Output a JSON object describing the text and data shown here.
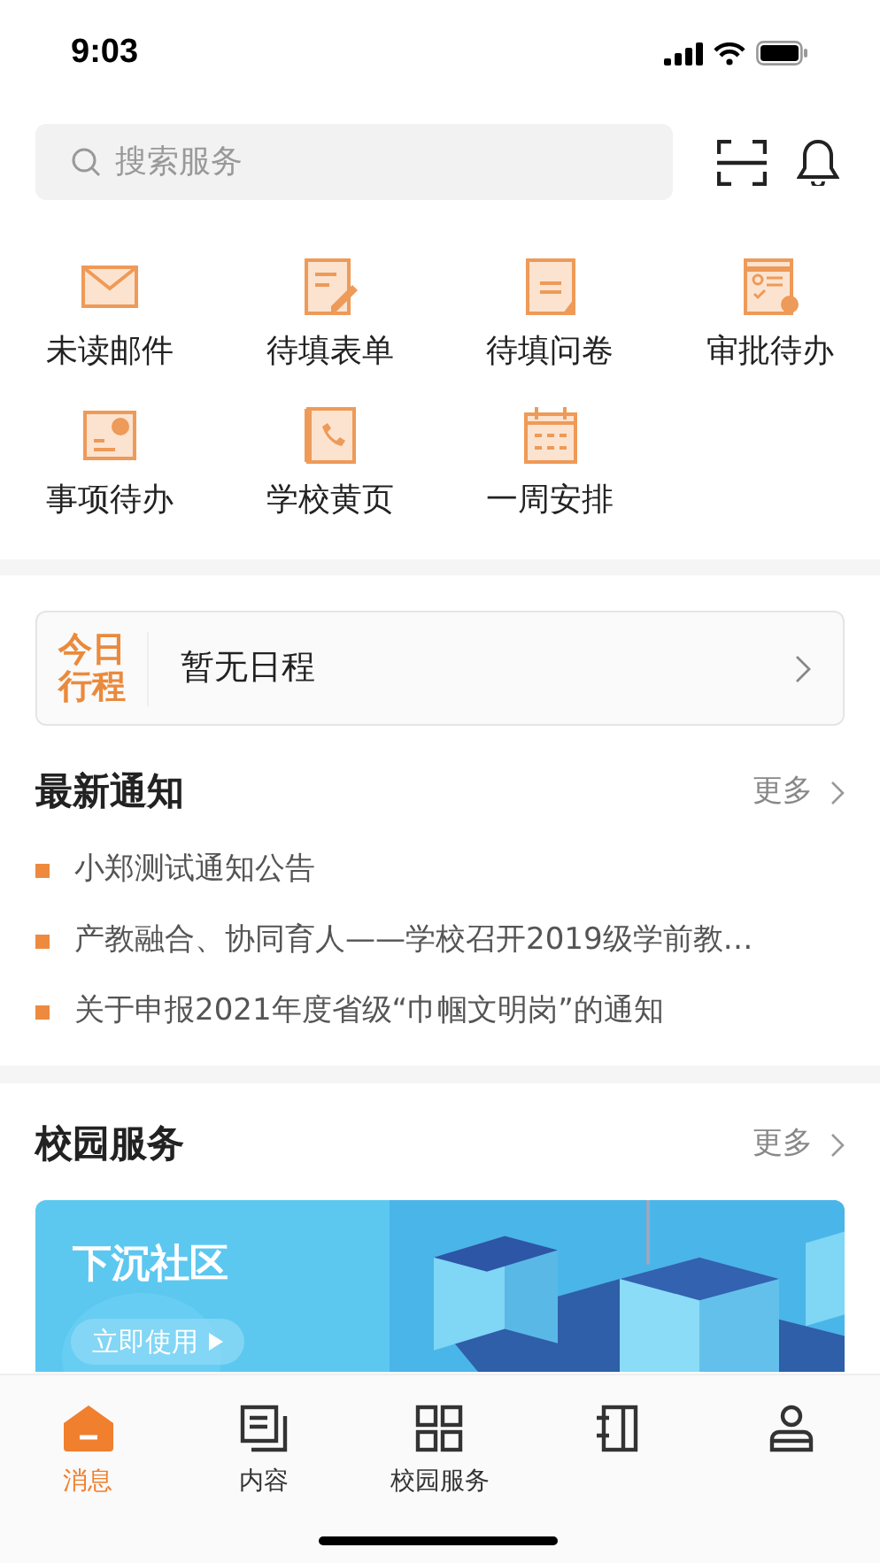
{
  "status_bar": {
    "time": "9:03"
  },
  "search": {
    "placeholder": "搜索服务"
  },
  "shortcuts": [
    {
      "label": "未读邮件",
      "kind": "mail"
    },
    {
      "label": "待填表单",
      "kind": "form"
    },
    {
      "label": "待填问卷",
      "kind": "survey"
    },
    {
      "label": "审批待办",
      "kind": "approval"
    },
    {
      "label": "事项待办",
      "kind": "task"
    },
    {
      "label": "学校黄页",
      "kind": "phonebook"
    },
    {
      "label": "一周安排",
      "kind": "calendar"
    }
  ],
  "schedule": {
    "badge_line_1": "今日",
    "badge_line_2": "行程",
    "text": "暂无日程"
  },
  "notices": {
    "title": "最新通知",
    "more": "更多",
    "items": [
      "小郑测试通知公告",
      "产教融合、协同育人——学校召开2019级学前教…",
      "关于申报2021年度省级“巾帼文明岗”的通知"
    ]
  },
  "campus_services": {
    "title": "校园服务",
    "more": "更多",
    "banner": {
      "kind": "picture",
      "title": "下沉社区",
      "button": "立即使用"
    }
  },
  "tab_bar": [
    {
      "label": "消息",
      "kind": "home",
      "selected": true
    },
    {
      "label": "内容",
      "kind": "content",
      "selected": false
    },
    {
      "label": "校园服务",
      "kind": "grid",
      "selected": false
    },
    {
      "kind": "notebook",
      "selected": false
    },
    {
      "kind": "person",
      "selected": false
    }
  ]
}
